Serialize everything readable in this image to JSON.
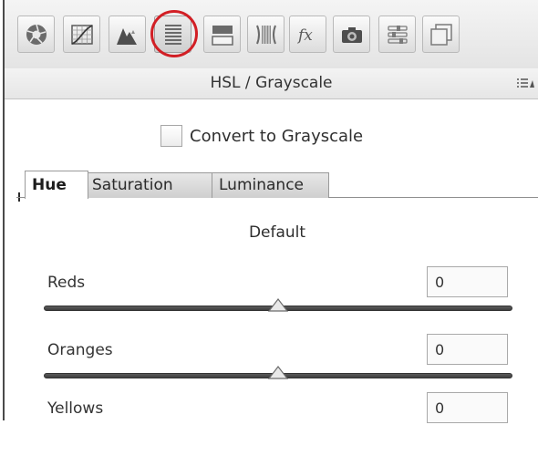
{
  "toolbar": {
    "buttons": [
      {
        "icon": "aperture-icon"
      },
      {
        "icon": "tone-curve-icon"
      },
      {
        "icon": "detail-icon"
      },
      {
        "icon": "hsl-grayscale-icon",
        "selected": true,
        "highlighted": true
      },
      {
        "icon": "split-toning-icon"
      },
      {
        "icon": "lens-corrections-icon"
      },
      {
        "icon": "effects-icon",
        "glyph": "fx"
      },
      {
        "icon": "camera-calibration-icon"
      },
      {
        "icon": "presets-icon"
      },
      {
        "icon": "snapshots-icon"
      }
    ],
    "highlight_color": "#d21f25"
  },
  "panel": {
    "title": "HSL / Grayscale",
    "menu_icon": "panel-menu-icon"
  },
  "convert": {
    "label": "Convert to Grayscale",
    "checked": false
  },
  "tabs": [
    {
      "label": "Hue",
      "active": true
    },
    {
      "label": "Saturation",
      "active": false
    },
    {
      "label": "Luminance",
      "active": false
    }
  ],
  "default_link": "Default",
  "sliders": [
    {
      "label": "Reds",
      "value": "0",
      "min": -100,
      "max": 100
    },
    {
      "label": "Oranges",
      "value": "0",
      "min": -100,
      "max": 100
    },
    {
      "label": "Yellows",
      "value": "0",
      "min": -100,
      "max": 100
    }
  ]
}
